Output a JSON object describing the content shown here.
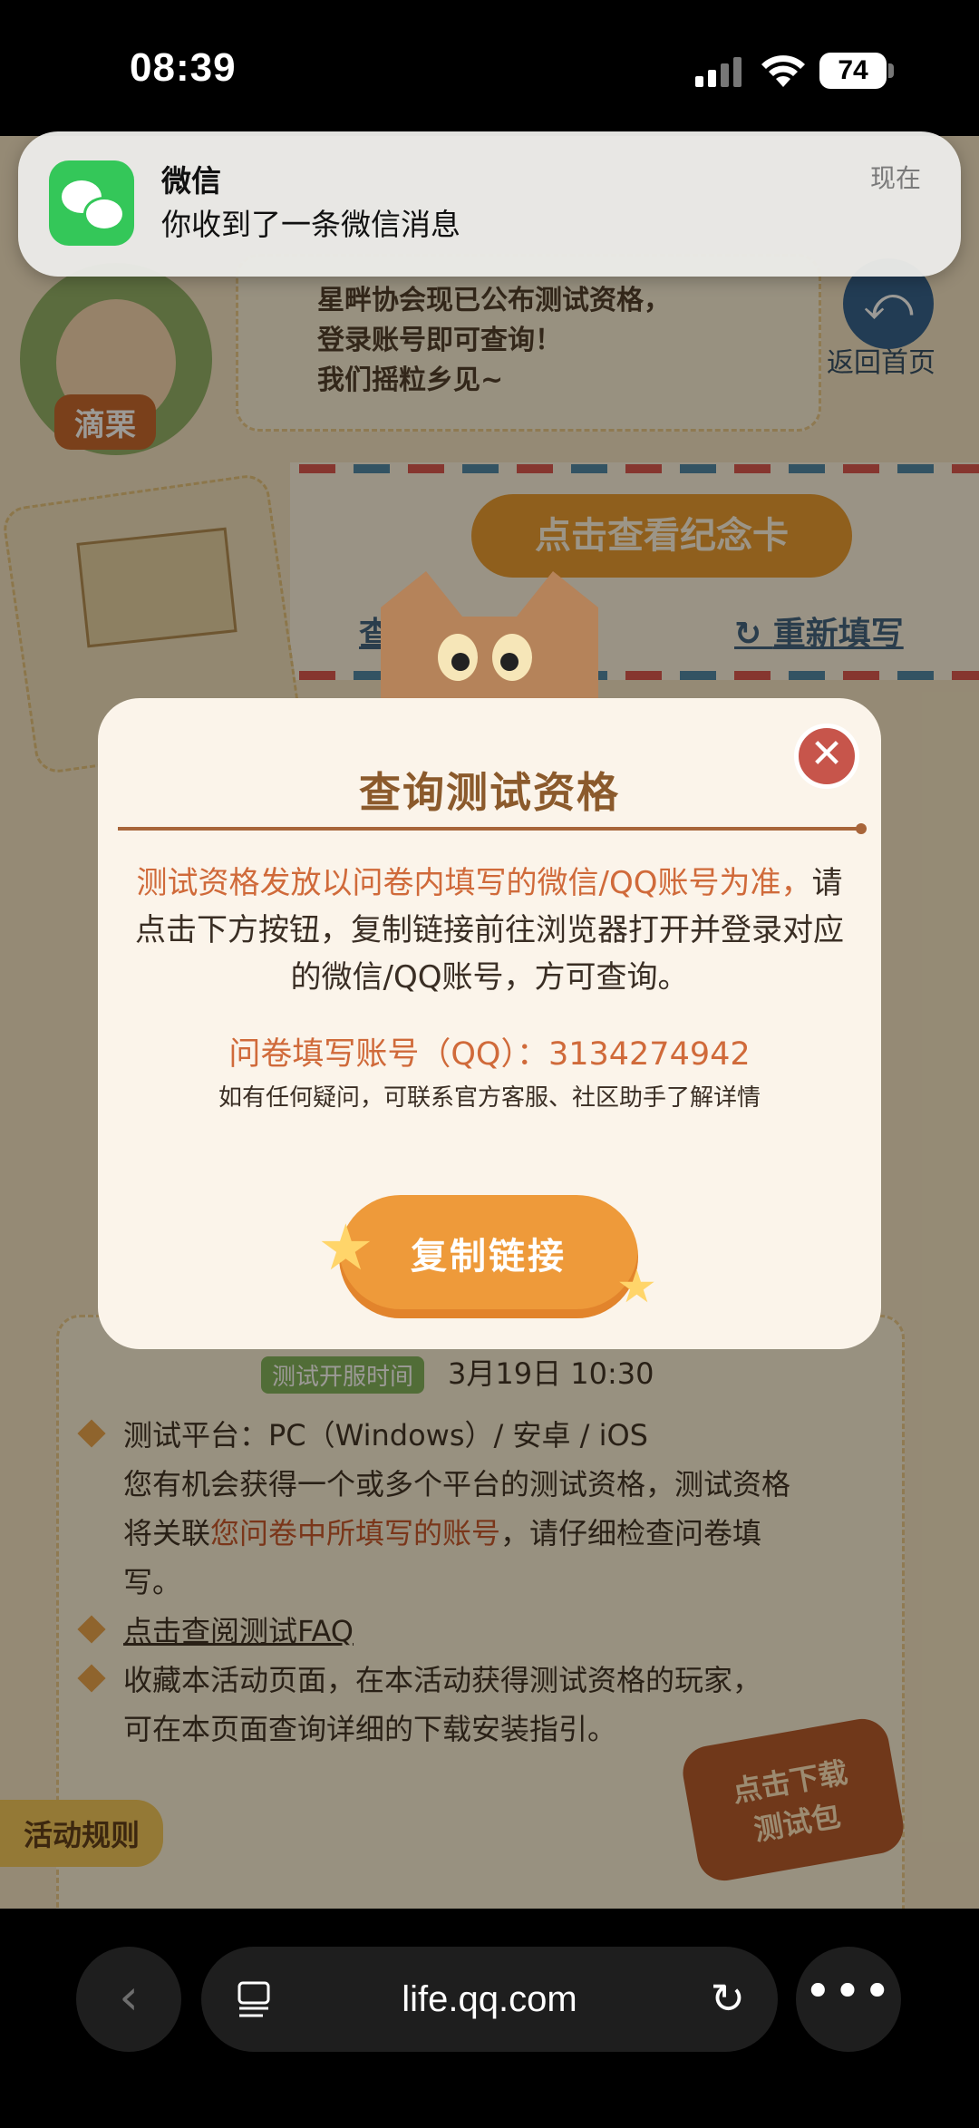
{
  "status_bar": {
    "time": "08:39",
    "battery": "74"
  },
  "notification": {
    "app": "微信",
    "message": "你收到了一条微信消息",
    "time": "现在"
  },
  "background": {
    "announcement": [
      "星畔协会现已公布测试资格，",
      "登录账号即可查询！",
      "我们摇粒乡见~"
    ],
    "character_name": "滴栗",
    "back_home": "返回首页",
    "view_card": "点击查看纪念卡",
    "view_record": "查看…记录",
    "refill": "重新填写",
    "rules_tab": "活动规则",
    "download": "点击下载\n测试包"
  },
  "modal": {
    "title": "查询测试资格",
    "desc_highlight": "测试资格发放以问卷内填写的微信/QQ账号为准，",
    "desc_rest": "请点击下方按钮，复制链接前往浏览器打开并登录对应的微信/QQ账号，方可查询。",
    "account": "问卷填写账号（QQ）：3134274942",
    "help": "如有任何疑问，可联系官方客服、社区助手了解详情",
    "copy_button": "复制链接"
  },
  "info": {
    "badge": "测试开服时间",
    "open_time": "3月19日 10:30",
    "platform": "测试平台：PC（Windows）/ 安卓 / iOS",
    "line2a": "您有机会获得一个或多个平台的测试资格，测试资格",
    "line3a": "将关联",
    "line3b": "您问卷中所填写的账号",
    "line3c": "，请仔细检查问卷填",
    "line4": "写。",
    "faq": "点击查阅测试FAQ",
    "line6": "收藏本活动页面，在本活动获得测试资格的玩家，",
    "line7": "可在本页面查询详细的下载安装指引。"
  },
  "browser": {
    "url": "life.qq.com"
  }
}
